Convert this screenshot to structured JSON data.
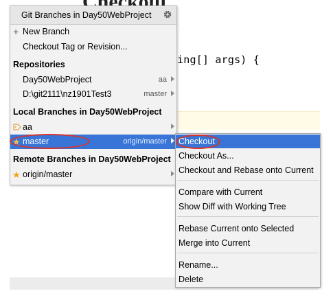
{
  "editor": {
    "heading": "Checkout",
    "code": "ing[] args) {"
  },
  "popup": {
    "title": "Git Branches in Day50WebProject",
    "new_branch": "New Branch",
    "checkout_tag": "Checkout Tag or Revision...",
    "repositories_header": "Repositories",
    "repositories": [
      {
        "name": "Day50WebProject",
        "branch": "aa"
      },
      {
        "name": "D:\\git2111\\nz1901Test3",
        "branch": "master"
      }
    ],
    "local_header": "Local Branches in Day50WebProject",
    "local": [
      {
        "name": "aa",
        "tracking": ""
      },
      {
        "name": "master",
        "tracking": "origin/master"
      }
    ],
    "remote_header": "Remote Branches in Day50WebProject",
    "remote": [
      {
        "name": "origin/master"
      }
    ]
  },
  "submenu": {
    "items": [
      "Checkout",
      "Checkout As...",
      "Checkout and Rebase onto Current",
      "Compare with Current",
      "Show Diff with Working Tree",
      "Rebase Current onto Selected",
      "Merge into Current",
      "Rename...",
      "Delete"
    ]
  },
  "colors": {
    "selection": "#3875d7",
    "highlight_oval": "#d9342b",
    "star": "#f0a30a"
  }
}
